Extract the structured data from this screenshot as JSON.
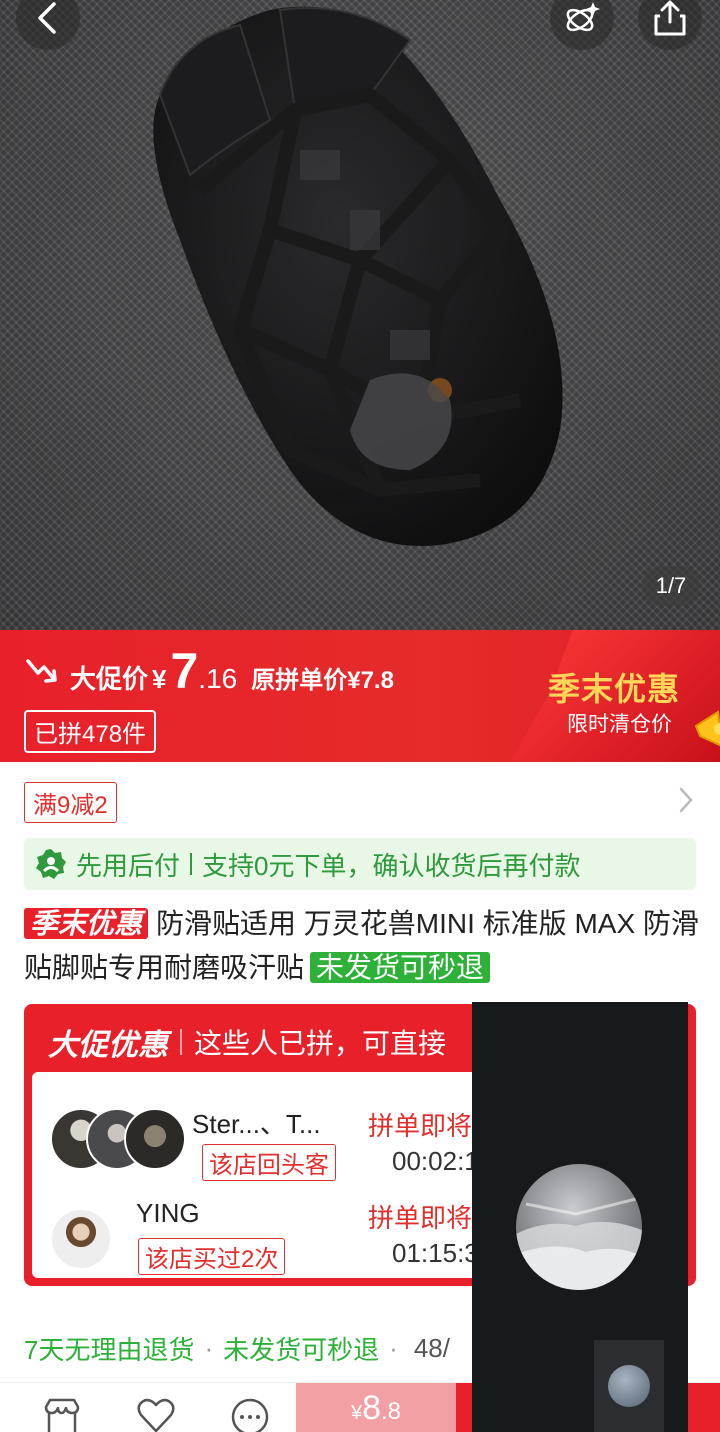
{
  "gallery": {
    "counter": "1/7"
  },
  "price_banner": {
    "label": "大促价",
    "currency": "¥",
    "price_int": "7",
    "price_dec": ".16",
    "original": "原拼单价¥7.8",
    "sold": "已拼478件",
    "campaign_title": "季末优惠",
    "campaign_sub": "限时清仓价"
  },
  "promo": {
    "coupon": "满9减2"
  },
  "paylater": {
    "part1": "先用后付",
    "part2": "支持0元下单，确认收货后再付款"
  },
  "product": {
    "tag": "季末优惠",
    "title": "防滑贴适用 万灵花兽MINI 标准版 MAX 防滑贴脚贴专用耐磨吸汗贴",
    "ship_tag": "未发货可秒退"
  },
  "group_buy": {
    "brand": "大促优惠",
    "header": "这些人已拼，可直接",
    "rows": [
      {
        "name": "Ster...、T...",
        "badge": "该店回头客",
        "status": "拼单即将",
        "timer": "00:02:1"
      },
      {
        "name": "YING",
        "badge": "该店买过2次",
        "status": "拼单即将",
        "timer": "01:15:3"
      }
    ]
  },
  "service": {
    "item1": "7天无理由退货",
    "item2": "未发货可秒退",
    "more": "48/"
  },
  "bottom_bar": {
    "currency": "¥",
    "price_int": "8",
    "price_dec": ".8"
  },
  "colors": {
    "accent": "#e8202a",
    "green": "#2eb138",
    "gold": "#ffd85a"
  }
}
